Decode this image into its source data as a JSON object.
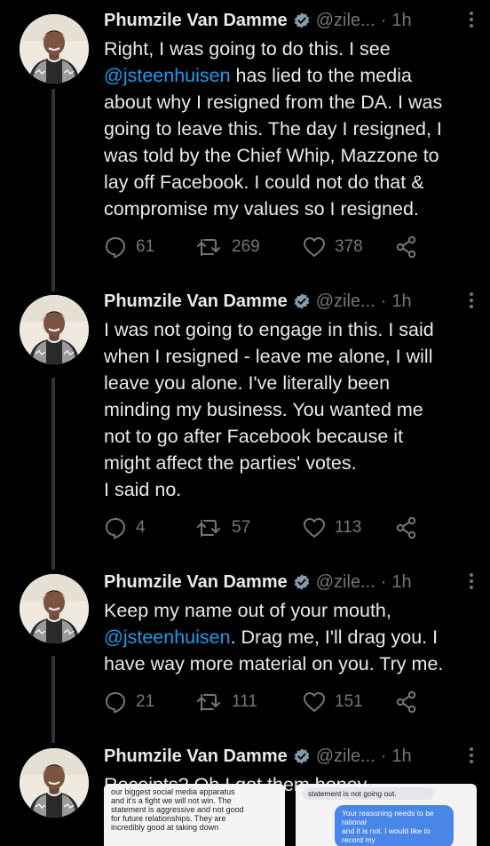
{
  "colors": {
    "background": "#000000",
    "text": "#e7e9ea",
    "muted": "#71767b",
    "link": "#1d9bf0",
    "verified": "#829aab"
  },
  "tweets": [
    {
      "name": "Phumzile Van Damme",
      "handle": "@zile...",
      "separator": "·",
      "time": "1h",
      "body_before": "Right, I was going to do this. I see\n",
      "mention": "@jsteenhuisen",
      "body_after": " has lied to the media\nabout why I resigned from the DA. I was\ngoing to leave this. The day I resigned, I\nwas told by the Chief Whip, Mazzone to\nlay off Facebook. I could not do that &\ncompromise my values so I resigned.",
      "replies": "61",
      "retweets": "269",
      "likes": "378"
    },
    {
      "name": "Phumzile Van Damme",
      "handle": "@zile...",
      "separator": "·",
      "time": "1h",
      "body_before": "I was not going to engage in this. I said\nwhen I resigned - leave me alone, I will\nleave you alone. I've literally been\nminding my business. You wanted me\nnot to go after Facebook because it\nmight affect the parties' votes.\nI said no.",
      "mention": "",
      "body_after": "",
      "replies": "4",
      "retweets": "57",
      "likes": "113"
    },
    {
      "name": "Phumzile Van Damme",
      "handle": "@zile...",
      "separator": "·",
      "time": "1h",
      "body_before": "Keep my name out of your mouth,\n",
      "mention": "@jsteenhuisen",
      "body_after": ". Drag me, I'll drag you. I\nhave way more material on you. Try me.",
      "replies": "21",
      "retweets": "111",
      "likes": "151"
    },
    {
      "name": "Phumzile Van Damme",
      "handle": "@zile...",
      "separator": "·",
      "time": "1h",
      "body_before": "Receipts? Oh I got them honey.",
      "mention": "",
      "body_after": ""
    }
  ],
  "media": {
    "left_text": "our biggest social media apparatus\nand it's a fight we will not win. The\nstatement is aggressive and not good\nfor future relationships. They are\nincredibly good at taking down",
    "right_top": "statement is not going out.",
    "right_bubble": "Your reasoning needs to be rational\nand it is not. I would like to record my"
  },
  "icons": {
    "more": "ellipsis-vertical-icon",
    "verified": "verified-badge-icon",
    "reply": "reply-icon",
    "retweet": "retweet-icon",
    "like": "heart-icon",
    "share": "share-icon"
  }
}
